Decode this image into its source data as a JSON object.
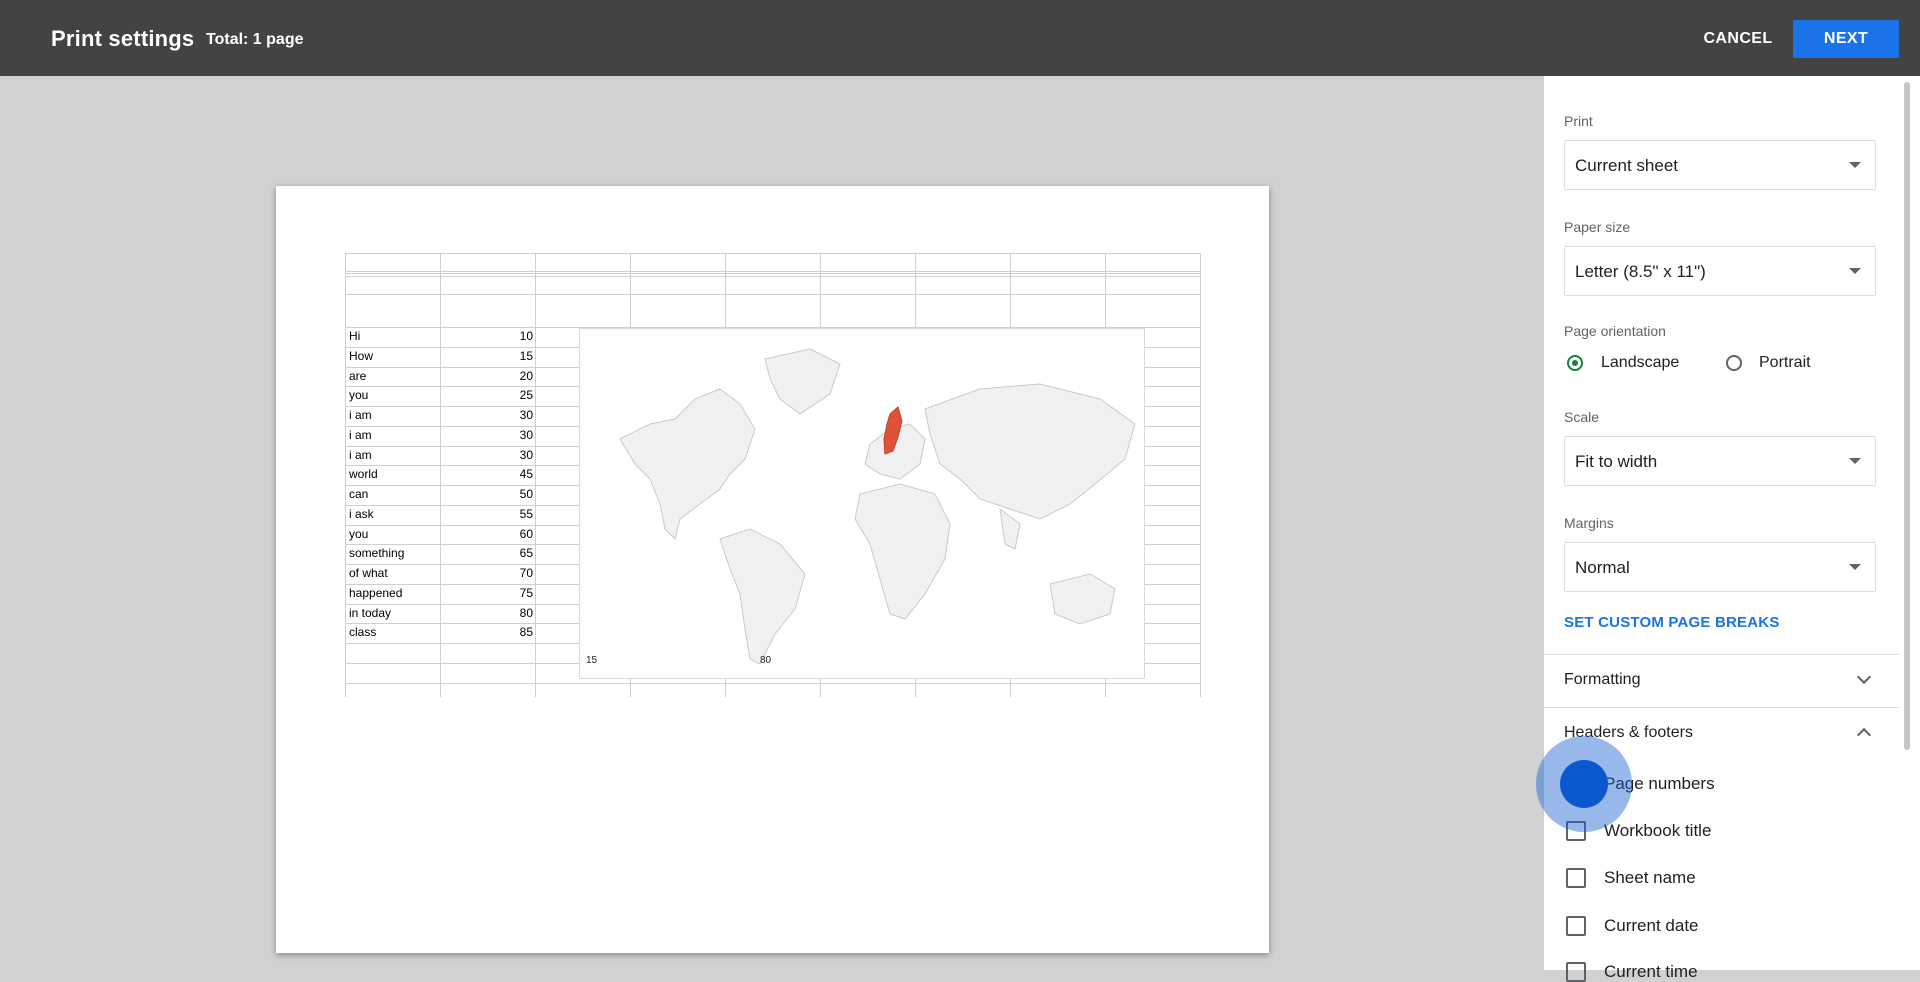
{
  "header": {
    "title": "Print settings",
    "total": "Total: 1 page",
    "cancel_label": "CANCEL",
    "next_label": "NEXT"
  },
  "preview": {
    "rows": [
      {
        "label": "Hi",
        "value": "10"
      },
      {
        "label": "How",
        "value": "15"
      },
      {
        "label": "are",
        "value": "20"
      },
      {
        "label": "you",
        "value": "25"
      },
      {
        "label": "i am",
        "value": "30"
      },
      {
        "label": "i am",
        "value": "30"
      },
      {
        "label": "i am",
        "value": "30"
      },
      {
        "label": "world",
        "value": "45"
      },
      {
        "label": "can",
        "value": "50"
      },
      {
        "label": "i ask",
        "value": "55"
      },
      {
        "label": "you",
        "value": "60"
      },
      {
        "label": "something",
        "value": "65"
      },
      {
        "label": "of what",
        "value": "70"
      },
      {
        "label": "happened",
        "value": "75"
      },
      {
        "label": "in today",
        "value": "80"
      },
      {
        "label": "class",
        "value": "85"
      }
    ],
    "map_legend_min": "15",
    "map_legend_max": "80",
    "highlight_color": "#e0513a"
  },
  "settings": {
    "print_label": "Print",
    "print_value": "Current sheet",
    "paper_size_label": "Paper size",
    "paper_size_value": "Letter (8.5\" x 11\")",
    "orientation_label": "Page orientation",
    "orientation_landscape": "Landscape",
    "orientation_portrait": "Portrait",
    "orientation_selected": "Landscape",
    "scale_label": "Scale",
    "scale_value": "Fit to width",
    "margins_label": "Margins",
    "margins_value": "Normal",
    "custom_breaks_link": "SET CUSTOM PAGE BREAKS",
    "formatting_section": "Formatting",
    "headers_footers_section": "Headers & footers",
    "checkboxes": [
      "Page numbers",
      "Workbook title",
      "Sheet name",
      "Current date",
      "Current time"
    ]
  },
  "colors": {
    "topbar": "#434343",
    "accent": "#1a73e8",
    "radio_selected": "#188038"
  }
}
